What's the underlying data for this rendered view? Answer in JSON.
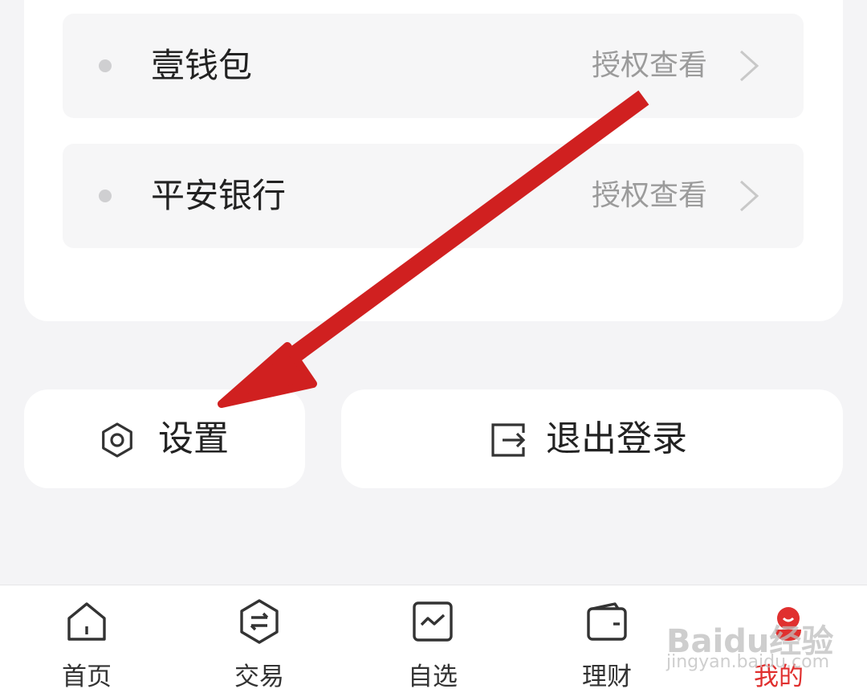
{
  "accounts": [
    {
      "name": "壹钱包",
      "action": "授权查看"
    },
    {
      "name": "平安银行",
      "action": "授权查看"
    }
  ],
  "buttons": {
    "settings_label": "设置",
    "logout_label": "退出登录"
  },
  "tabbar": {
    "items": [
      {
        "label": "首页",
        "icon": "home-icon"
      },
      {
        "label": "交易",
        "icon": "exchange-icon"
      },
      {
        "label": "自选",
        "icon": "watchlist-chart-icon"
      },
      {
        "label": "理财",
        "icon": "wallet-icon"
      },
      {
        "label": "我的",
        "icon": "profile-icon",
        "active": true
      }
    ]
  },
  "watermark": {
    "main": "Baidu经验",
    "sub": "jingyan.baidu.com"
  },
  "colors": {
    "accent": "#e0302f",
    "annotation_arrow": "#d02020"
  }
}
